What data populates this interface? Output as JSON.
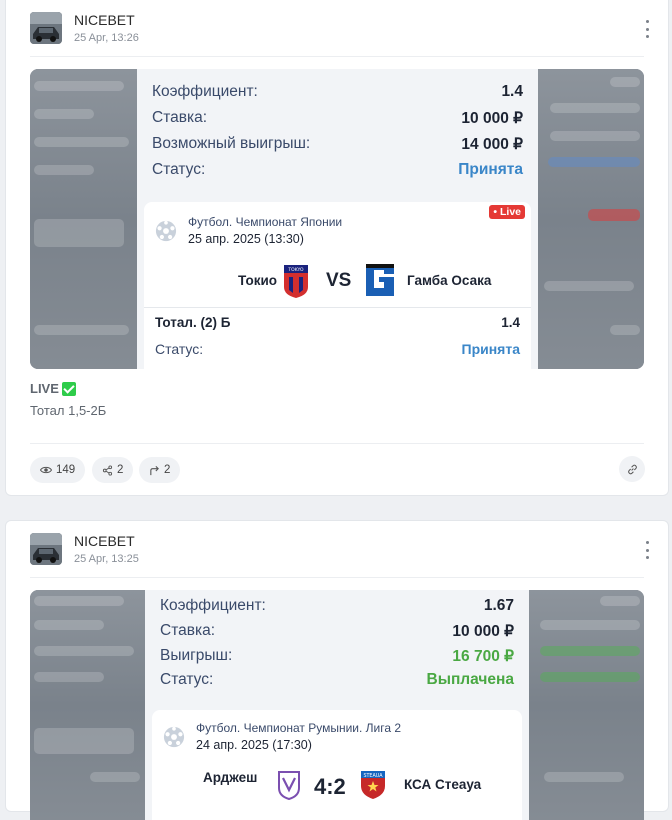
{
  "posts": [
    {
      "channel": "NICEBET",
      "date": "25 Apr, 13:26",
      "bet": {
        "coef_label": "Коэффициент:",
        "coef_value": "1.4",
        "stake_label": "Ставка:",
        "stake_value": "10 000 ₽",
        "win_label": "Возможный выигрыш:",
        "win_value": "14 000 ₽",
        "status_label": "Статус:",
        "status_value": "Принята"
      },
      "match": {
        "league": "Футбол. Чемпионат Японии",
        "date": "25 апр. 2025 (13:30)",
        "live_badge": "• Live",
        "team1": "Токио",
        "team1_logo_text": "TOKYO",
        "vs": "VS",
        "team2": "Гамба Осака",
        "market": "Тотал. (2) Б",
        "market_value": "1.4",
        "status_label": "Статус:",
        "status_value": "Принята"
      },
      "live_label": "LIVE",
      "caption": "Тотал 1,5-2Б",
      "stats": {
        "views": "149",
        "shares": "2",
        "forwards": "2"
      }
    },
    {
      "channel": "NICEBET",
      "date": "25 Apr, 13:25",
      "bet": {
        "coef_label": "Коэффициент:",
        "coef_value": "1.67",
        "stake_label": "Ставка:",
        "stake_value": "10 000 ₽",
        "win_label": "Выигрыш:",
        "win_value": "16 700 ₽",
        "status_label": "Статус:",
        "status_value": "Выплачена"
      },
      "match": {
        "league": "Футбол. Чемпионат Румынии. Лига 2",
        "date": "24 апр. 2025 (17:30)",
        "team1": "Арджеш",
        "score": "4:2",
        "team2": "КСА Стеауа",
        "team2_logo_text": "STEAUA"
      }
    }
  ],
  "colors": {
    "accent_blue": "#3a86c8",
    "paid_green": "#4aa843",
    "live_red": "#e53935"
  }
}
